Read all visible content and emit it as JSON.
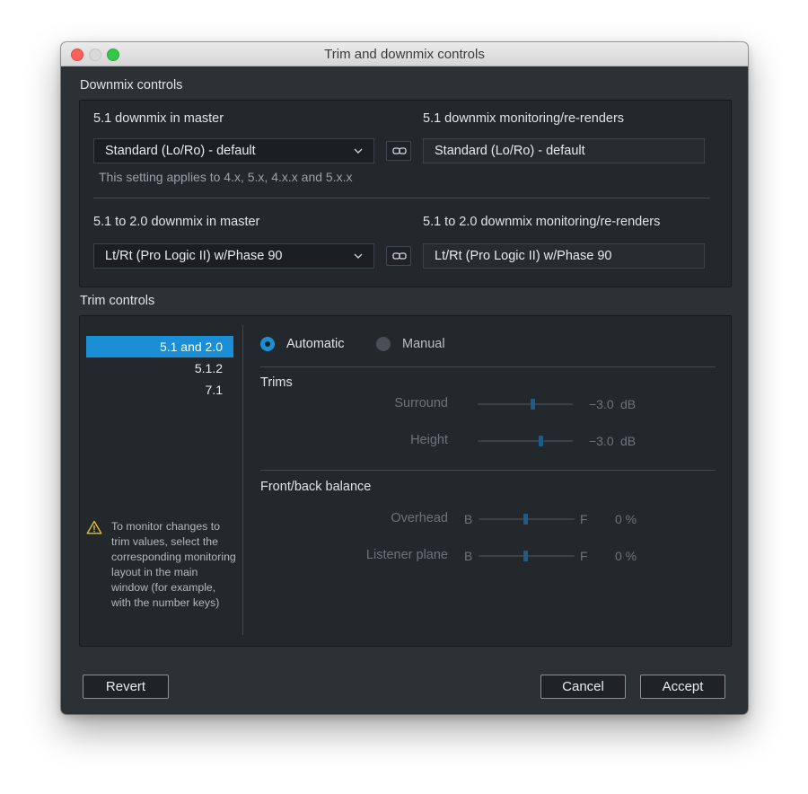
{
  "window": {
    "title": "Trim and downmix controls"
  },
  "downmix": {
    "section_label": "Downmix controls",
    "row1": {
      "master_label": "5.1 downmix in master",
      "master_value": "Standard (Lo/Ro) - default",
      "monitor_label": "5.1 downmix monitoring/re-renders",
      "monitor_value": "Standard (Lo/Ro) - default",
      "hint": "This setting applies to 4.x, 5.x, 4.x.x and 5.x.x"
    },
    "row2": {
      "master_label": "5.1 to 2.0 downmix in master",
      "master_value": "Lt/Rt (Pro Logic II) w/Phase 90",
      "monitor_label": "5.1 to 2.0 downmix monitoring/re-renders",
      "monitor_value": "Lt/Rt (Pro Logic II) w/Phase 90"
    }
  },
  "trim": {
    "section_label": "Trim controls",
    "layouts": [
      "5.1 and 2.0",
      "5.1.2",
      "7.1"
    ],
    "selected_layout": "5.1 and 2.0",
    "warning": "To monitor changes to trim values, select the corresponding monitoring layout in the main window (for example, with the number keys)",
    "mode_automatic": "Automatic",
    "mode_manual": "Manual",
    "mode_selected": "Automatic",
    "trims_heading": "Trims",
    "surround": {
      "label": "Surround",
      "value": "−3.0",
      "unit": "dB"
    },
    "height": {
      "label": "Height",
      "value": "−3.0",
      "unit": "dB"
    },
    "balance_heading": "Front/back balance",
    "overhead": {
      "label": "Overhead",
      "left": "B",
      "right": "F",
      "value": "0 %"
    },
    "listener": {
      "label": "Listener plane",
      "left": "B",
      "right": "F",
      "value": "0 %"
    }
  },
  "buttons": {
    "revert": "Revert",
    "cancel": "Cancel",
    "accept": "Accept"
  },
  "colors": {
    "accent": "#1a8fd6",
    "background": "#2c3136",
    "panel": "#23282c"
  }
}
